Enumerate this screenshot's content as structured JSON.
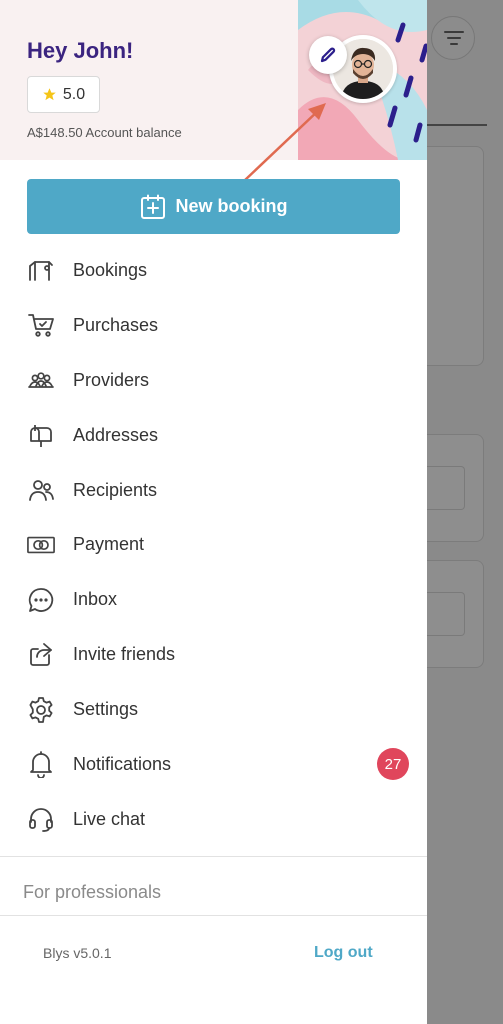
{
  "header": {
    "greeting": "Hey John!",
    "rating": "5.0",
    "balance": "A$148.50 Account balance"
  },
  "actions": {
    "new_booking": "New booking"
  },
  "menu": {
    "items": [
      {
        "label": "Bookings",
        "icon": "bookings-icon"
      },
      {
        "label": "Purchases",
        "icon": "cart-icon"
      },
      {
        "label": "Providers",
        "icon": "providers-icon"
      },
      {
        "label": "Addresses",
        "icon": "mailbox-icon"
      },
      {
        "label": "Recipients",
        "icon": "recipients-icon"
      },
      {
        "label": "Payment",
        "icon": "payment-icon"
      },
      {
        "label": "Inbox",
        "icon": "chat-bubble-icon"
      },
      {
        "label": "Invite friends",
        "icon": "share-icon"
      },
      {
        "label": "Settings",
        "icon": "gear-icon"
      },
      {
        "label": "Notifications",
        "icon": "bell-icon",
        "badge": "27"
      },
      {
        "label": "Live chat",
        "icon": "headset-icon"
      }
    ]
  },
  "footer": {
    "section_label": "For professionals",
    "version": "Blys v5.0.1",
    "logout": "Log out"
  },
  "colors": {
    "brand_purple": "#3b2480",
    "accent_blue": "#4fa8c7",
    "badge_red": "#e0465c",
    "header_bg": "#f9f1f1"
  }
}
